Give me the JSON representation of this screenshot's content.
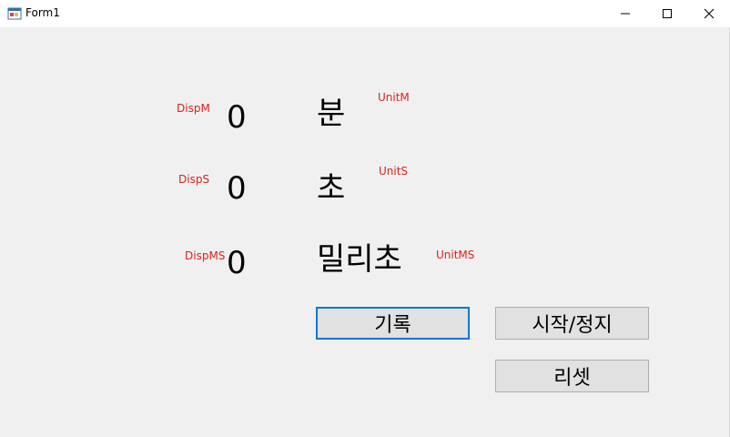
{
  "window": {
    "title": "Form1",
    "controls": {
      "minimize": "minimize-icon",
      "maximize": "maximize-icon",
      "close": "close-icon"
    }
  },
  "display": {
    "minutes": {
      "debug_label": "DispM",
      "value": "0",
      "unit": "분",
      "unit_debug_label": "UnitM"
    },
    "seconds": {
      "debug_label": "DispS",
      "value": "0",
      "unit": "초",
      "unit_debug_label": "UnitS"
    },
    "milliseconds": {
      "debug_label": "DispMS",
      "value": "0",
      "unit": "밀리초",
      "unit_debug_label": "UnitMS"
    }
  },
  "buttons": {
    "record": "기록",
    "start_stop": "시작/정지",
    "reset": "리셋"
  },
  "colors": {
    "debug_label": "#e0201c",
    "client_bg": "#f0f0f0",
    "button_bg": "#e1e1e1",
    "focus_border": "#0078d7"
  }
}
